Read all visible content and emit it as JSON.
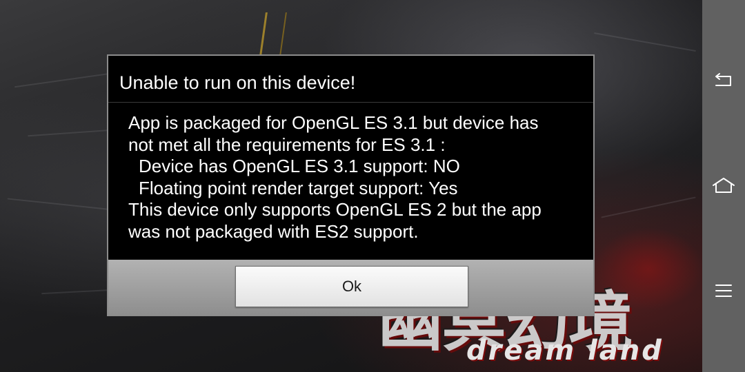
{
  "dialog": {
    "title": "Unable to run on this device!",
    "message_lines": [
      "App is packaged for OpenGL ES 3.1 but device has",
      "not met all the requirements for ES 3.1 :",
      "Device has OpenGL ES 3.1 support: NO",
      "Floating point render target support: Yes",
      "This device only supports OpenGL ES 2 but the app",
      "was not packaged with ES2 support."
    ],
    "ok_label": "Ok"
  },
  "background": {
    "logo_cjk": "幽冥幻境",
    "logo_en": "dream land"
  },
  "navbar": {
    "back_icon": "back-icon",
    "home_icon": "home-icon",
    "menu_icon": "menu-icon"
  },
  "colors": {
    "dialog_bg": "#000000",
    "footer_bg": "#a0a0a0",
    "navbar_bg": "#616161"
  }
}
